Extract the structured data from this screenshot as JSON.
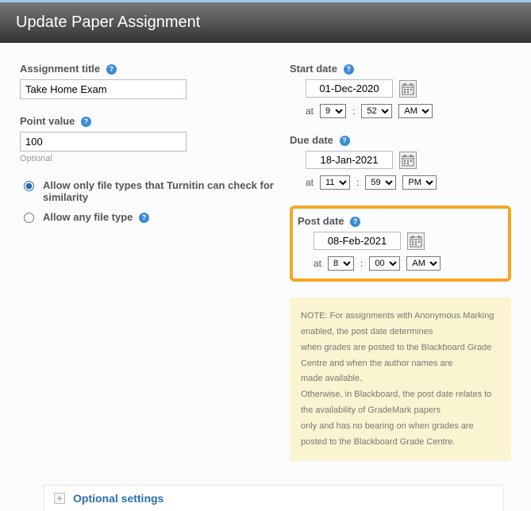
{
  "header": {
    "title": "Update Paper Assignment"
  },
  "left": {
    "assignment_title_label": "Assignment title",
    "assignment_title_value": "Take Home Exam",
    "point_value_label": "Point value",
    "point_value_value": "100",
    "optional_text": "Optional",
    "radio_only_label": "Allow only file types that Turnitin can check for similarity",
    "radio_any_label": "Allow any file type"
  },
  "right": {
    "start": {
      "label": "Start date",
      "date": "01-Dec-2020",
      "at": "at",
      "h": "9",
      "m": "52",
      "ap": "AM"
    },
    "due": {
      "label": "Due date",
      "date": "18-Jan-2021",
      "at": "at",
      "h": "11",
      "m": "59",
      "ap": "PM"
    },
    "post": {
      "label": "Post date",
      "date": "08-Feb-2021",
      "at": "at",
      "h": "8",
      "m": "00",
      "ap": "AM"
    },
    "colon": ":"
  },
  "note": {
    "l1": "NOTE: For assignments with Anonymous Marking enabled, the post date determines",
    "l2": "when grades are posted to the Blackboard Grade Centre and when the author names are",
    "l3": "made available.",
    "l4": "Otherwise, in Blackboard, the post date relates to the availability of GradeMark papers",
    "l5": "only and has no bearing on when grades are posted to the Blackboard Grade Centre."
  },
  "bottom": {
    "optional_settings": "Optional settings"
  },
  "icons": {
    "help": "?"
  }
}
